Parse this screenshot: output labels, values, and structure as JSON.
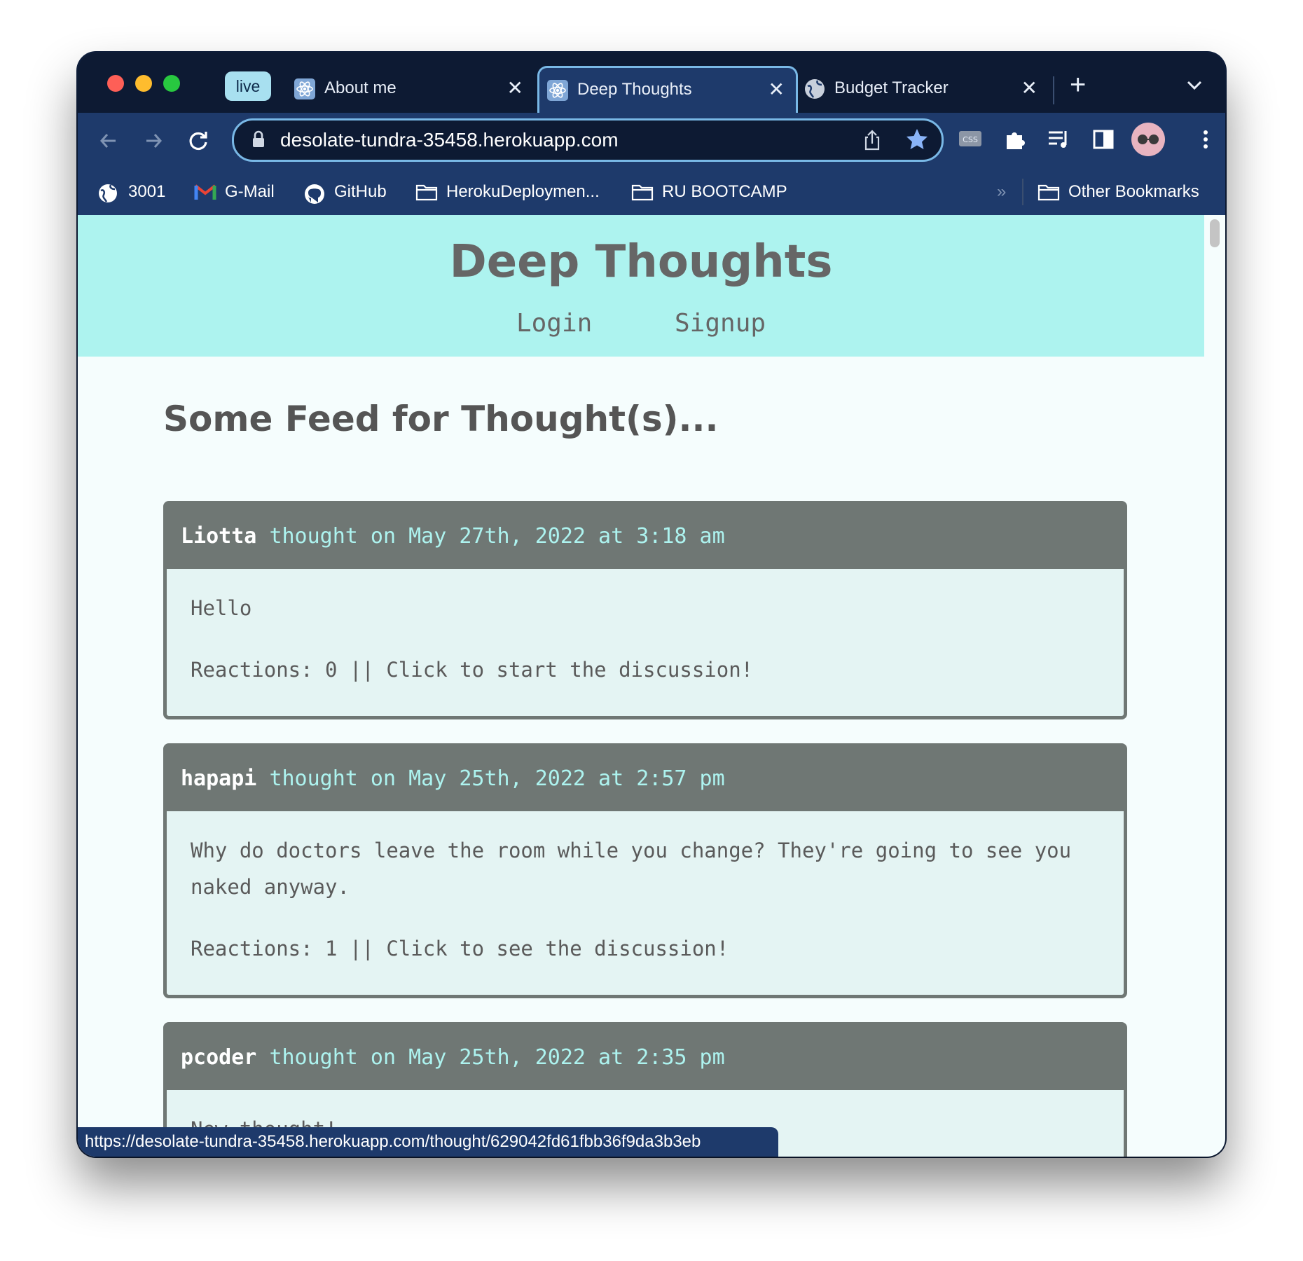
{
  "browser": {
    "tabs": [
      {
        "label": "live"
      },
      {
        "label": "About me"
      },
      {
        "label": "Deep Thoughts"
      },
      {
        "label": "Budget Tracker"
      }
    ],
    "url": "desolate-tundra-35458.herokuapp.com",
    "status_url": "https://desolate-tundra-35458.herokuapp.com/thought/629042fd61fbb36f9da3b3eb",
    "bookmarks": [
      {
        "label": "3001"
      },
      {
        "label": "G-Mail"
      },
      {
        "label": "GitHub"
      },
      {
        "label": "HerokuDeploymen..."
      },
      {
        "label": "RU BOOTCAMP"
      },
      {
        "label": "Other Bookmarks"
      }
    ]
  },
  "site": {
    "title": "Deep Thoughts",
    "nav": {
      "login": "Login",
      "signup": "Signup"
    },
    "feed_title": "Some Feed for Thought(s)...",
    "thoughts": [
      {
        "user": "Liotta",
        "meta": "thought on May 27th, 2022 at 3:18 am",
        "text": "Hello",
        "reactions": "Reactions: 0 || Click to start the discussion!"
      },
      {
        "user": "hapapi",
        "meta": "thought on May 25th, 2022 at 2:57 pm",
        "text": "Why do doctors leave the room while you change? They're going to see you naked anyway.",
        "reactions": "Reactions: 1 || Click to see the discussion!"
      },
      {
        "user": "pcoder",
        "meta": "thought on May 25th, 2022 at 2:35 pm",
        "text": "New thought!",
        "reactions": ""
      }
    ]
  },
  "colors": {
    "header_bg": "#adf3ef",
    "card_header": "#6f7774",
    "card_meta": "#adf3ef",
    "browser_chrome": "#1e3a6b"
  }
}
